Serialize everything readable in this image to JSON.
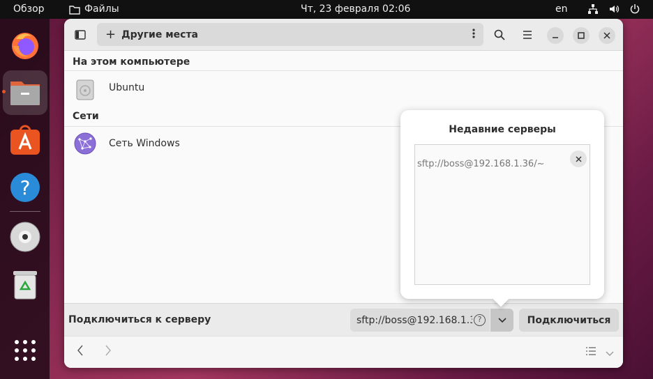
{
  "topbar": {
    "overview": "Обзор",
    "app_name": "Файлы",
    "clock": "Чт, 23 февраля  02:06",
    "language": "en"
  },
  "dock": {
    "apps": [
      "firefox-icon",
      "files-icon",
      "app-center-icon",
      "help-icon",
      "disc-icon",
      "trash-icon",
      "app-grid-icon"
    ]
  },
  "header": {
    "location": "Другие места",
    "plus": "+"
  },
  "sections": {
    "computer": {
      "title": "На этом компьютере",
      "items": [
        "Ubuntu"
      ]
    },
    "networks": {
      "title": "Сети",
      "items": [
        "Сеть Windows"
      ]
    }
  },
  "connect_bar": {
    "label": "Подключиться к серверу",
    "address": "sftp://boss@192.168.1.36/~",
    "help": "?",
    "connect_button": "Подключиться"
  },
  "popover": {
    "title": "Недавние серверы",
    "servers": [
      "sftp://boss@192.168.1.36/~"
    ]
  },
  "colors": {
    "accent": "#e95420",
    "window_bg": "#fafafa",
    "headerbar_bg": "#ebebeb"
  }
}
